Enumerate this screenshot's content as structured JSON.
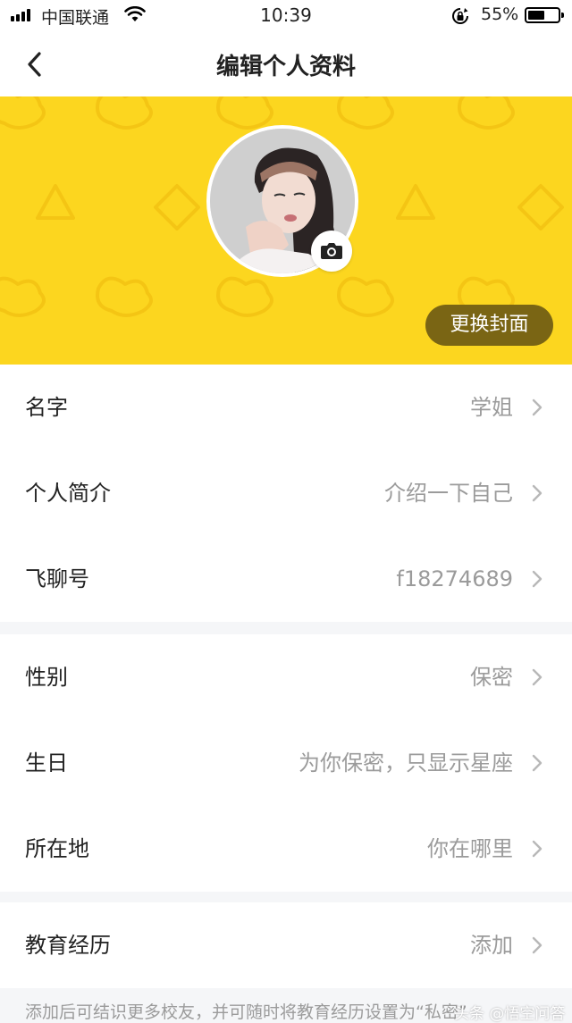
{
  "status_bar": {
    "carrier": "中国联通",
    "time": "10:39",
    "battery_percent": "55%",
    "battery_level": 0.55
  },
  "nav": {
    "back_icon": "chevron-left-icon",
    "title": "编辑个人资料"
  },
  "banner": {
    "background_color": "#fcd61f",
    "camera_icon": "camera-icon",
    "change_cover_label": "更换封面"
  },
  "groups": [
    {
      "rows": [
        {
          "label": "名字",
          "value": "学姐"
        },
        {
          "label": "个人简介",
          "value": "介绍一下自己"
        },
        {
          "label": "飞聊号",
          "value": "f18274689"
        }
      ]
    },
    {
      "rows": [
        {
          "label": "性别",
          "value": "保密"
        },
        {
          "label": "生日",
          "value": "为你保密，只显示星座"
        },
        {
          "label": "所在地",
          "value": "你在哪里"
        }
      ]
    },
    {
      "rows": [
        {
          "label": "教育经历",
          "value": "添加"
        }
      ]
    }
  ],
  "education_note": "添加后可结识更多校友，并可随时将教育经历设置为“私密”",
  "watermark": "头条 @悟空问答"
}
